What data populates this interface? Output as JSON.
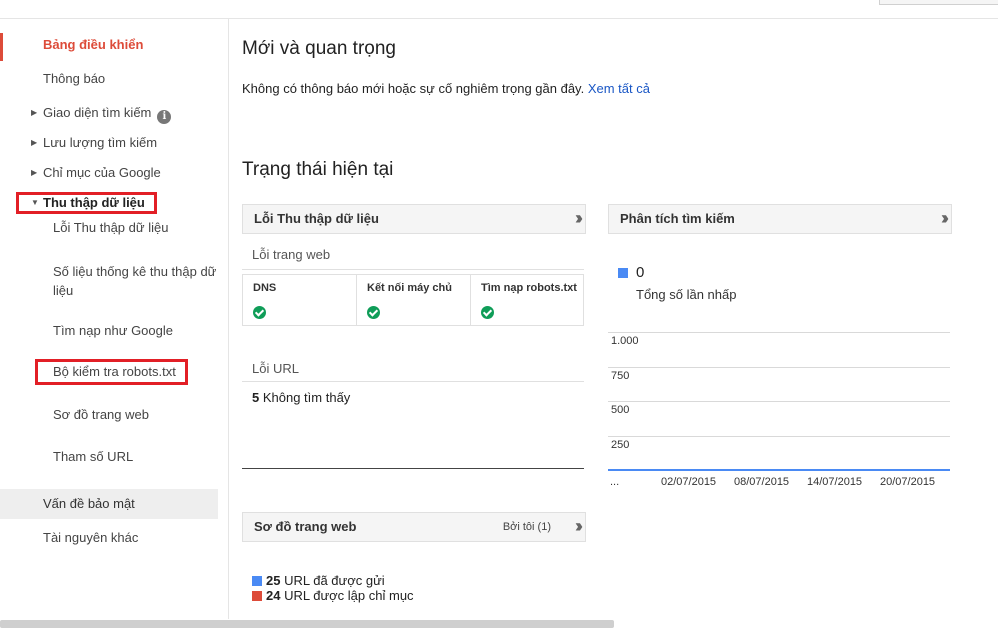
{
  "sidebar": {
    "items": [
      {
        "label": "Bảng điều khiển"
      },
      {
        "label": "Thông báo"
      },
      {
        "label": "Giao diện tìm kiếm"
      },
      {
        "label": "Lưu lượng tìm kiếm"
      },
      {
        "label": "Chỉ mục của Google"
      },
      {
        "label": "Thu thập dữ liệu"
      },
      {
        "label": "Lỗi Thu thập dữ liệu"
      },
      {
        "label": "Số liệu thống kê thu thập dữ",
        "label2": "liệu"
      },
      {
        "label": "Tìm nạp như Google"
      },
      {
        "label": "Bộ kiểm tra robots.txt"
      },
      {
        "label": "Sơ đồ trang web"
      },
      {
        "label": "Tham số URL"
      },
      {
        "label": "Vấn đề bảo mật"
      },
      {
        "label": "Tài nguyên khác"
      }
    ],
    "info_icon": "i"
  },
  "main": {
    "important_title": "Mới và quan trọng",
    "important_text": "Không có thông báo mới hoặc sự cố nghiêm trọng gần đây.",
    "see_all": "Xem tất cả",
    "status_title": "Trạng thái hiện tại",
    "crawl_errors": {
      "title": "Lỗi Thu thập dữ liệu",
      "site_errors": "Lỗi trang web",
      "columns": [
        "DNS",
        "Kết nối máy chủ",
        "Tìm nạp robots.txt"
      ],
      "url_errors": "Lỗi URL",
      "not_found_count": "5",
      "not_found_label": "Không tìm thấy"
    },
    "search_analytics": {
      "title": "Phân tích tìm kiếm",
      "clicks_value": "0",
      "clicks_label": "Tổng số lần nhấp",
      "series_color": "#4a8af4"
    },
    "sitemaps": {
      "title": "Sơ đồ trang web",
      "by_me": "Bởi tôi (1)",
      "submitted_count": "25",
      "submitted_label": "URL đã được gửi",
      "indexed_count": "24",
      "indexed_label": "URL được lập chỉ mục",
      "submitted_color": "#4a8af4",
      "indexed_color": "#dd4b39"
    }
  },
  "chart_data": {
    "type": "line",
    "x": [
      "...",
      "02/07/2015",
      "08/07/2015",
      "14/07/2015",
      "20/07/2015"
    ],
    "yticks": [
      "1.000",
      "750",
      "500",
      "250"
    ],
    "ylim": [
      0,
      1000
    ],
    "values": [
      0,
      0,
      0,
      0,
      0
    ]
  }
}
